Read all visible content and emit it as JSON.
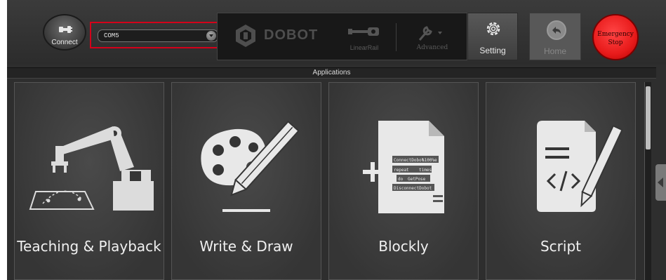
{
  "toolbar": {
    "connect_label": "Connect",
    "port_value": "COM5",
    "brand": "DOBOT",
    "linear_rail_label": "LinearRail",
    "advanced_label": "Advanced",
    "setting_label": "Setting",
    "home_label": "Home",
    "estop_line1": "Emergency",
    "estop_line2": "Stop"
  },
  "applications": {
    "header": "Applications",
    "cards": [
      {
        "label": "Teaching & Playback",
        "icon": "robot-arm-icon"
      },
      {
        "label": "Write & Draw",
        "icon": "palette-pencil-icon"
      },
      {
        "label": "Blockly",
        "icon": "blockly-document-icon"
      },
      {
        "label": "Script",
        "icon": "script-document-icon"
      }
    ],
    "blockly_snippet": {
      "line1": "ConnectDobot",
      "line1b": "%100%e",
      "line2": "repeat",
      "line2b": "times",
      "line3": "do",
      "line3b": "GetPose",
      "line4": "DisconnectDobot"
    }
  },
  "colors": {
    "background": "#2e2e2e",
    "highlight": "#d4001a",
    "estop": "#e81b1b"
  }
}
